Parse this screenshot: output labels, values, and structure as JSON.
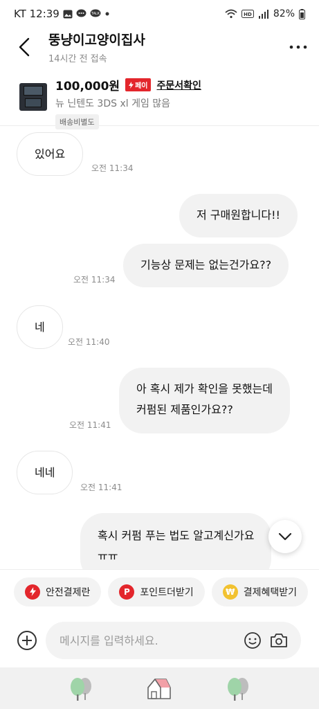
{
  "status_bar": {
    "carrier_time": "KT 12:39",
    "battery": "82%"
  },
  "header": {
    "title": "뚱냥이고양이집사",
    "subtitle": "14시간 전 접속"
  },
  "product": {
    "price": "100,000원",
    "pay_badge": "페이",
    "order_link": "주문서확인",
    "name": "뉴 닌텐도 3DS xl 게임 많음",
    "shipping_tag": "배송비별도"
  },
  "messages": [
    {
      "side": "in",
      "text": "있어요",
      "time": "오전 11:34"
    },
    {
      "side": "out",
      "text": "저 구매원합니다!!"
    },
    {
      "side": "out",
      "text": "기능상 문제는 없는건가요??",
      "time": "오전 11:34"
    },
    {
      "side": "in",
      "text": "네",
      "time": "오전 11:40"
    },
    {
      "side": "out",
      "line1": "아 혹시 제가 확인을 못했는데",
      "line2": "커펌된 제품인가요??",
      "time": "오전 11:41"
    },
    {
      "side": "in",
      "text": "네네",
      "time": "오전 11:41"
    },
    {
      "side": "out",
      "line1": "혹시 커펌 푸는 법도 알고계신가요",
      "line2": "ㅠㅠ"
    }
  ],
  "quick_actions": [
    {
      "label": "안전결제란",
      "icon": "lightning-icon",
      "color": "#e3262c"
    },
    {
      "label": "포인트더받기",
      "icon": "p-point-icon",
      "color": "#e3262c"
    },
    {
      "label": "결제혜택받기",
      "icon": "won-coin-icon",
      "color": "#f2c230"
    }
  ],
  "input": {
    "placeholder": "메시지를 입력하세요."
  },
  "colors": {
    "accent": "#e3262c",
    "bubble_out": "#f2f2f2",
    "muted": "#8c8c8c"
  }
}
